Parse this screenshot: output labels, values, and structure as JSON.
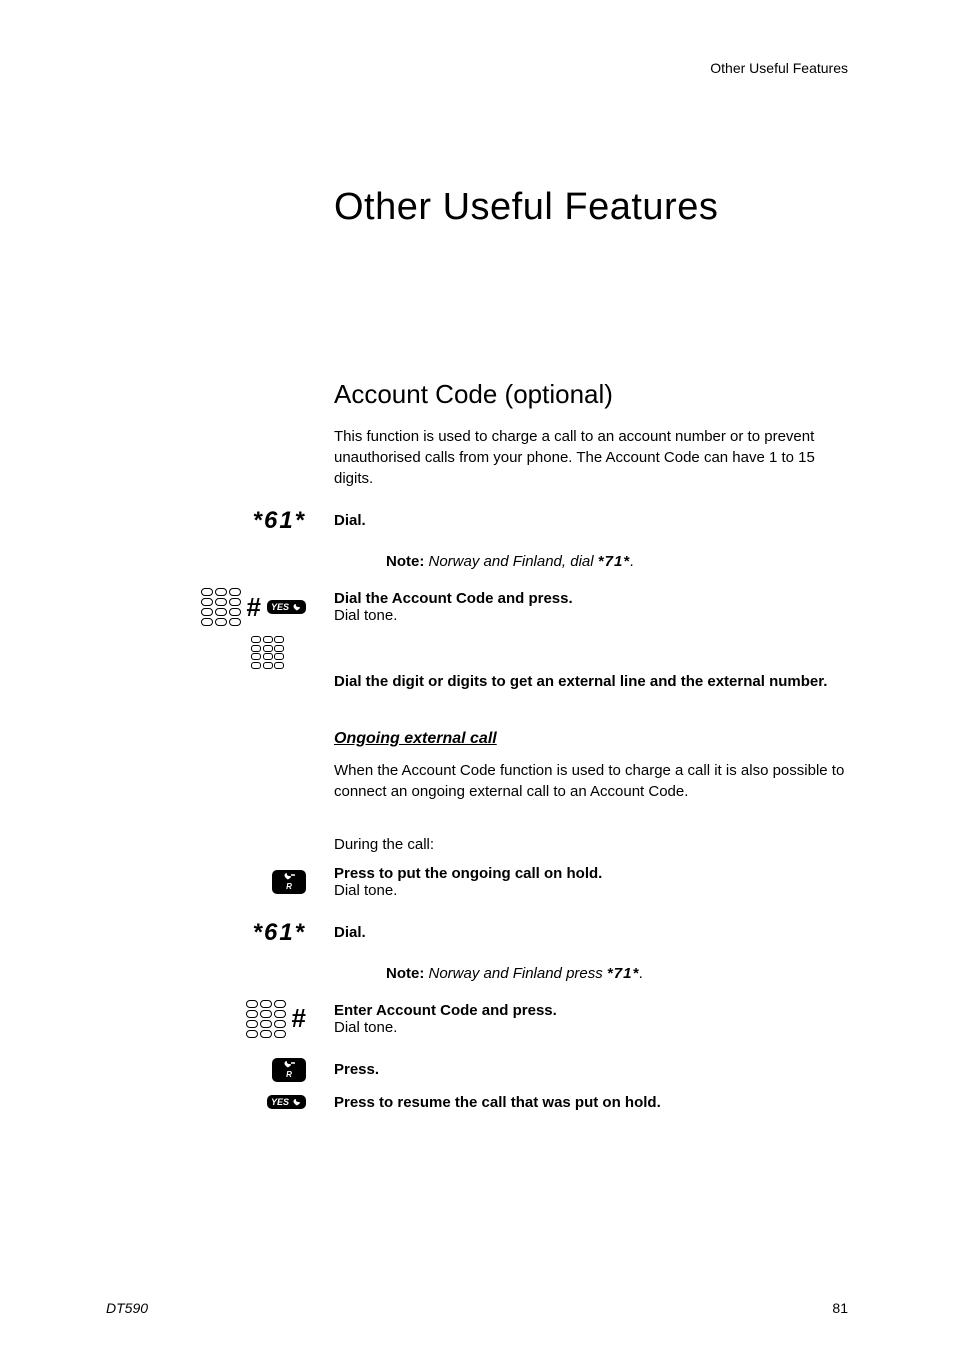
{
  "header": {
    "right": "Other Useful Features"
  },
  "title": "Other Useful Features",
  "section": {
    "title": "Account Code (optional)",
    "intro": "This function is used to charge a call to an account number or to prevent unauthorised calls from your phone. The Account Code can have 1 to 15 digits.",
    "dial1": {
      "code": "*61*",
      "label": "Dial."
    },
    "note1": {
      "prefix": "Note:",
      "text": " Norway and Finland, dial ",
      "code": "*71*",
      "suffix": "."
    },
    "step2": {
      "bold": "Dial the Account Code and press.",
      "line": "Dial tone."
    },
    "step3": {
      "bold": "Dial the digit or digits to get an external line and the external number."
    },
    "sub": {
      "title": "Ongoing external call",
      "intro": "When the Account Code function is used to charge a call it is also possible to connect an ongoing external call to an Account Code.",
      "during": "During the call:",
      "hold": {
        "bold": "Press to put the ongoing call on hold.",
        "line": "Dial tone."
      },
      "dial2": {
        "code": "*61*",
        "label": "Dial."
      },
      "note2": {
        "prefix": "Note:",
        "text": " Norway and Finland press ",
        "code": "*71*",
        "suffix": "."
      },
      "enter": {
        "bold": "Enter Account Code and press.",
        "line": "Dial tone."
      },
      "press": {
        "bold": "Press."
      },
      "resume": {
        "bold": "Press to resume the call that was put on hold."
      }
    }
  },
  "icons": {
    "yes": "YES",
    "r": "R"
  },
  "footer": {
    "left": "DT590",
    "right": "81"
  }
}
